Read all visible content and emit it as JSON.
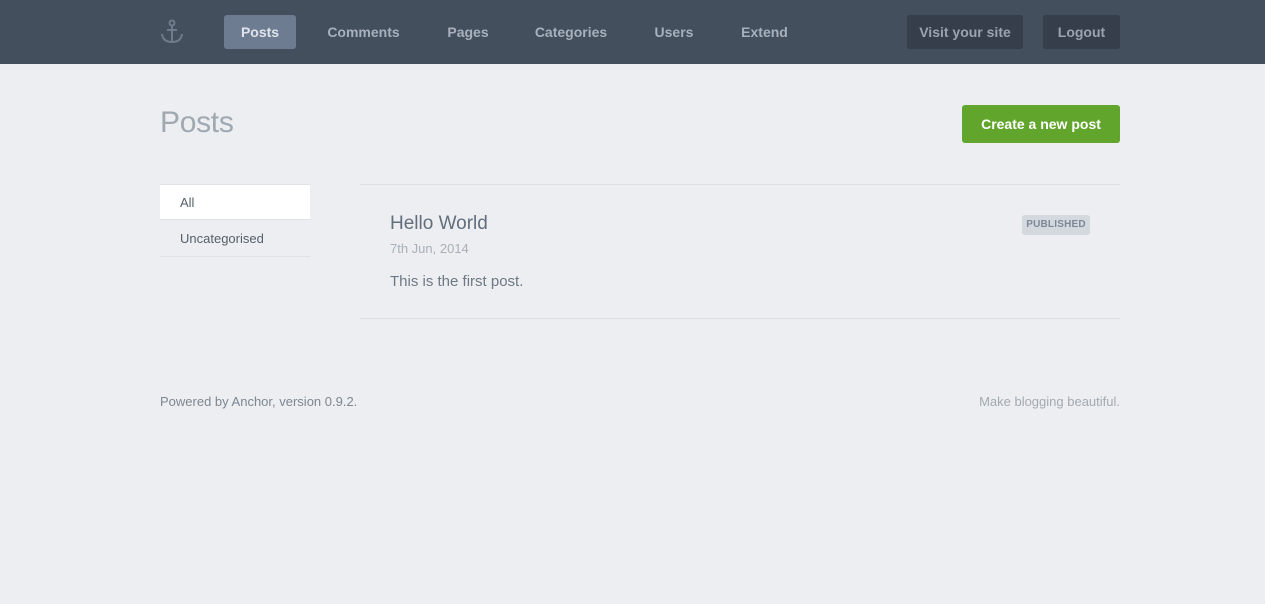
{
  "nav": {
    "items": [
      {
        "label": "Posts",
        "active": true
      },
      {
        "label": "Comments"
      },
      {
        "label": "Pages"
      },
      {
        "label": "Categories"
      },
      {
        "label": "Users"
      },
      {
        "label": "Extend"
      }
    ],
    "visit_site": "Visit your site",
    "logout": "Logout"
  },
  "page": {
    "title": "Posts",
    "create_button": "Create a new post"
  },
  "categories": [
    {
      "label": "All",
      "active": true
    },
    {
      "label": "Uncategorised"
    }
  ],
  "posts": [
    {
      "title": "Hello World",
      "date": "7th Jun, 2014",
      "excerpt": "This is the first post.",
      "status": "PUBLISHED"
    }
  ],
  "footer": {
    "powered_by": "Powered by Anchor, version 0.9.2.",
    "tagline": "Make blogging beautiful."
  },
  "colors": {
    "topbar": "#444f5d",
    "nav_active": "#6e7c92",
    "accent_green": "#62a52d",
    "background": "#eceef1"
  },
  "icons": {
    "logo": "anchor-icon"
  }
}
